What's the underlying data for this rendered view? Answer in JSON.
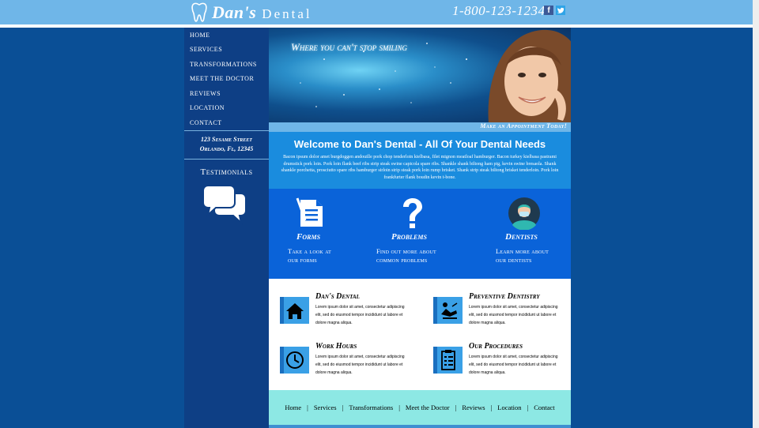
{
  "header": {
    "logo_name": "Dan's",
    "logo_dental": "Dental",
    "phone": "1-800-123-1234",
    "social": [
      {
        "icon": "facebook-icon",
        "glyph": "f"
      },
      {
        "icon": "twitter-icon",
        "glyph": "t"
      }
    ]
  },
  "sidebar": {
    "nav": [
      {
        "label": "Home"
      },
      {
        "label": "Services"
      },
      {
        "label": "Transformations"
      },
      {
        "label": "Meet the Doctor"
      },
      {
        "label": "Reviews"
      },
      {
        "label": "Location"
      },
      {
        "label": "Contact"
      }
    ],
    "address_line1": "123 Sesame Street",
    "address_line2": "Orlando, Fl, 12345",
    "testimonials": "Testimonials"
  },
  "hero": {
    "tagline": "Where you can't stop smiling",
    "appointment": "Make an Appointment Today!"
  },
  "welcome": {
    "title": "Welcome to Dan's Dental - All Of Your Dental Needs",
    "body": "Bacon ipsum dolor amet burgdoggen andouille pork chop tenderloin kielbasa, filet mignon meatloaf hamburger. Bacon turkey kielbasa pastrami drumstick pork loin. Pork loin flank beef ribs strip steak swine capicola spare ribs. Shankle shank biltong ham pig, kevin swine bresaola. Shank shankle porchetta, prosciutto spare ribs hamburger sirloin strip steak pork loin rump brisket. Shank strip steak biltong brisket tenderloin. Pork loin frankfurter flank boudin kevin t-bone."
  },
  "features": [
    {
      "title": "Forms",
      "desc_line1": "Take a look at",
      "desc_line2": "our forms",
      "icon": "document-icon"
    },
    {
      "title": "Problems",
      "desc_line1": "Find out more about",
      "desc_line2": "common problems",
      "icon": "question-mark-icon"
    },
    {
      "title": "Dentists",
      "desc_line1": "Learn more about",
      "desc_line2": "our dentists",
      "icon": "dentist-avatar-icon"
    }
  ],
  "cards": [
    {
      "title": "Dan's Dental",
      "icon": "house-icon",
      "body": "Lorem ipsum dolor sit amet, consectetur adipiscing elit, sed do eiusmod tempor incididunt ut labore et dolore magna aliqua."
    },
    {
      "title": "Preventive Dentistry",
      "icon": "dental-chair-icon",
      "body": "Lorem ipsum dolor sit amet, consectetur adipiscing elit, sed do eiusmod tempor incididunt ut labore et dolore magna aliqua."
    },
    {
      "title": "Work Hours",
      "icon": "clock-icon",
      "body": "Lorem ipsum dolor sit amet, consectetur adipiscing elit, sed do eiusmod tempor incididunt ut labore et dolore magna aliqua."
    },
    {
      "title": "Our Procedures",
      "icon": "clipboard-icon",
      "body": "Lorem ipsum dolor sit amet, consectetur adipiscing elit, sed do eiusmod tempor incididunt ut labore et dolore magna aliqua."
    }
  ],
  "footer": {
    "links": [
      "Home",
      "Services",
      "Transformations",
      "Meet the Doctor",
      "Reviews",
      "Location",
      "Contact"
    ],
    "separator": "|"
  },
  "colors": {
    "topbar": "#6fb6e8",
    "page_bg": "#0a4f96",
    "sidebar": "#0e3f85",
    "welcome": "#1a8cde",
    "features": "#0a63d9",
    "footer": "#8de8e4",
    "icon_tile": "#3aa0e6"
  }
}
